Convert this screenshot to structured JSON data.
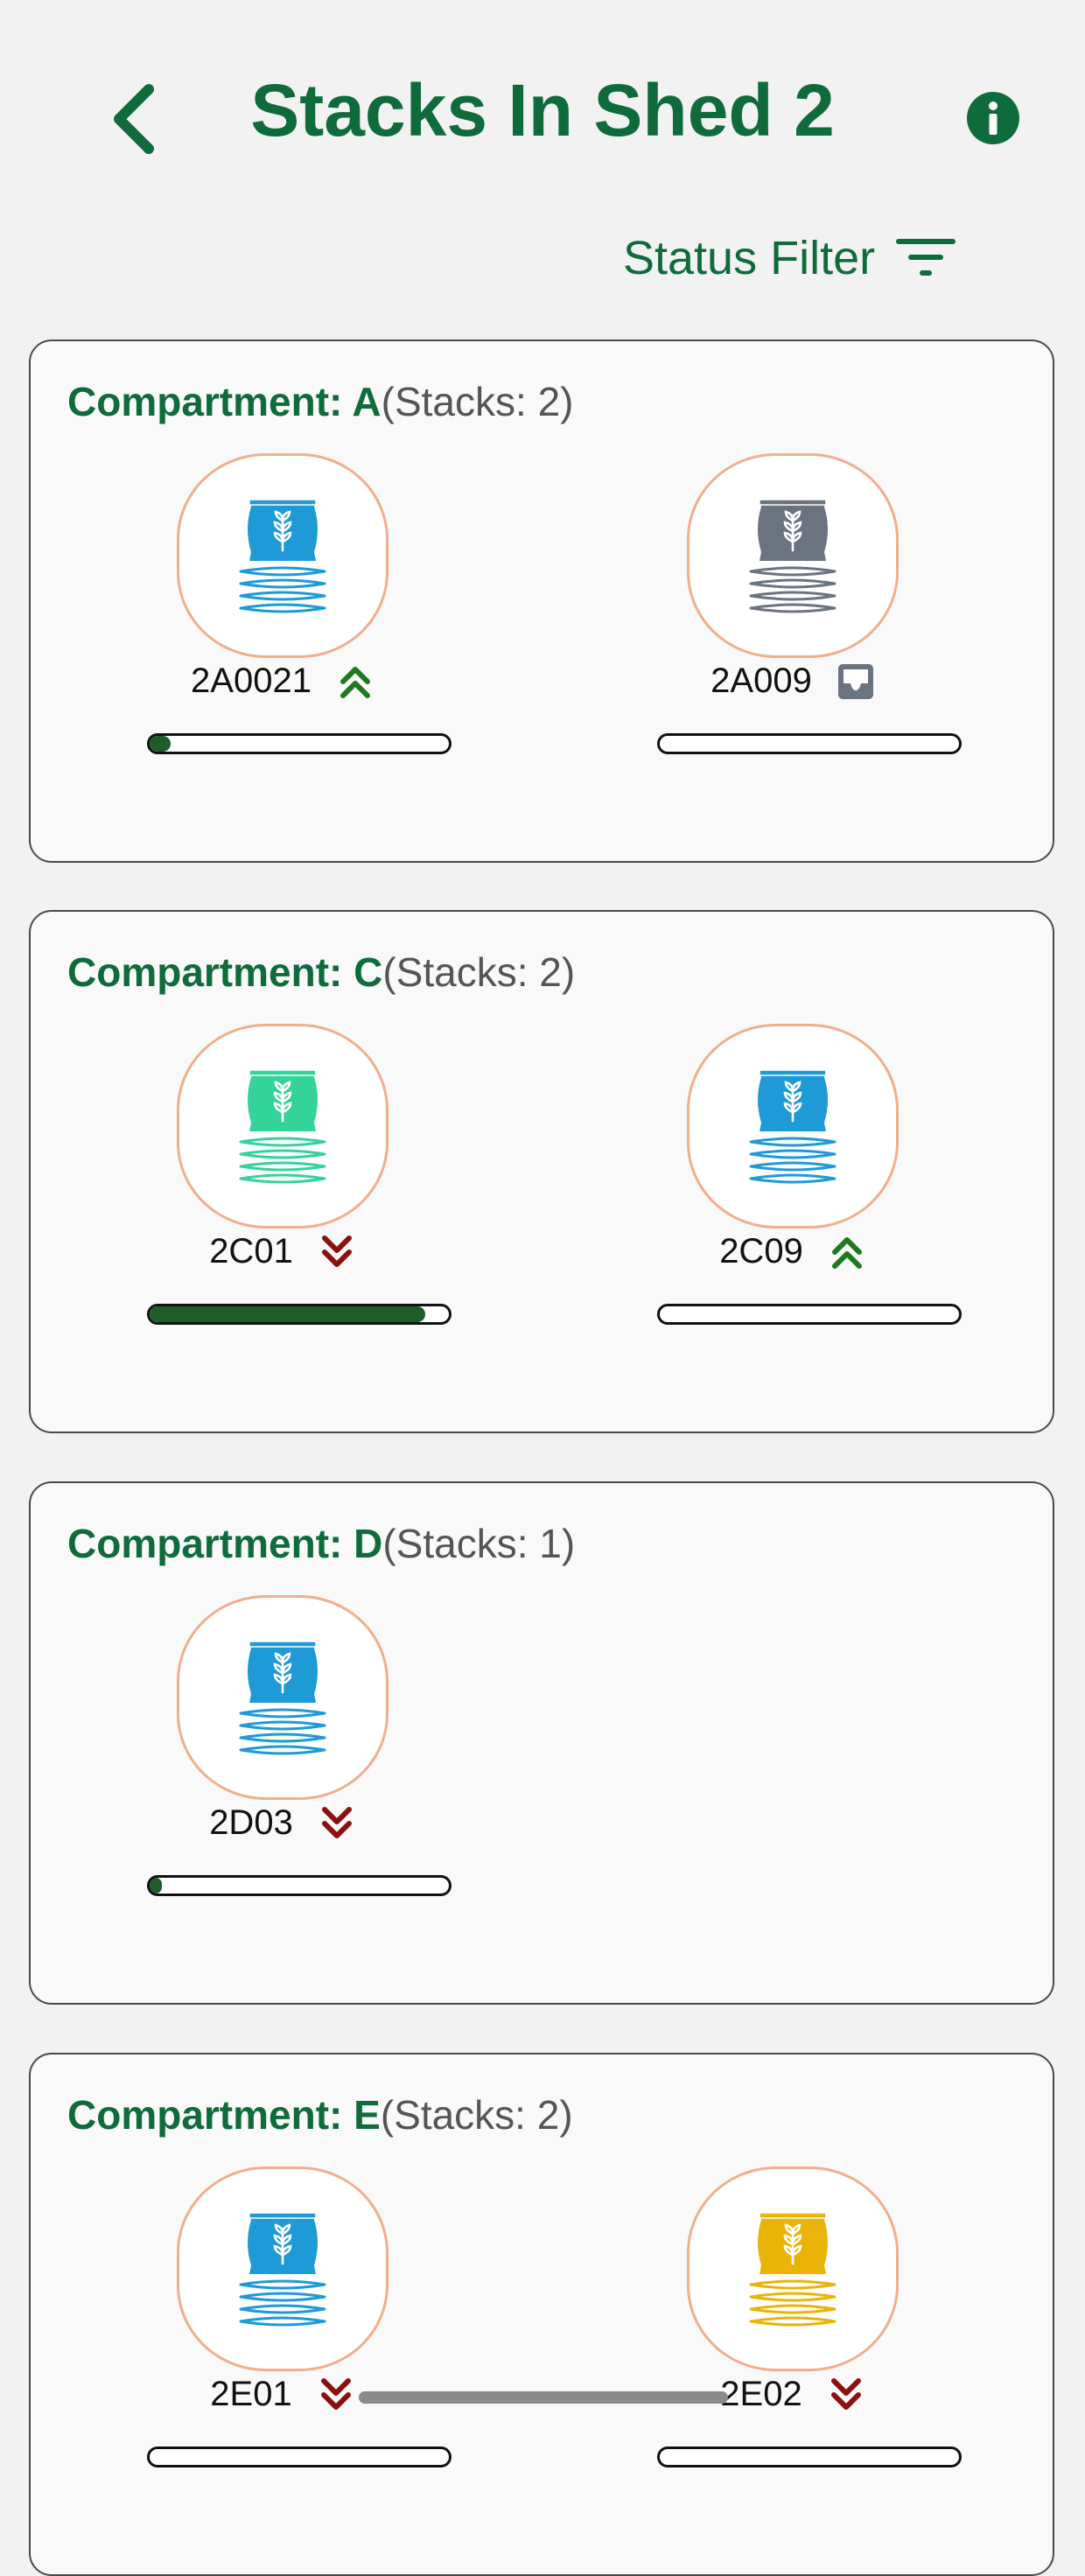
{
  "header": {
    "title": "Stacks In Shed 2",
    "back_icon": "chevron-left-icon",
    "info_icon": "info-icon"
  },
  "filter": {
    "label": "Status Filter",
    "icon": "filter-lines-icon"
  },
  "colors": {
    "brand_green": "#0f6b3c",
    "progress_fill": "#1e5c2a",
    "circle_border": "#efaf8c",
    "trend_up": "#1e7a1e",
    "trend_down": "#8b1010",
    "sack_blue": "#1e9ad6",
    "sack_gray": "#6b7280",
    "sack_green": "#34d399",
    "sack_yellow": "#eab308"
  },
  "compartments": [
    {
      "label": "Compartment: A",
      "count": "(Stacks: 2)",
      "stacks": [
        {
          "id": "2A0021",
          "status_icon": "double-chevron-up-icon",
          "sack_color": "#1e9ad6",
          "progress": 0.07
        },
        {
          "id": "2A009",
          "status_icon": "inbox-tray-icon",
          "sack_color": "#6b7280",
          "progress": 0.0
        }
      ]
    },
    {
      "label": "Compartment: C",
      "count": "(Stacks: 2)",
      "stacks": [
        {
          "id": "2C01",
          "status_icon": "double-chevron-down-icon",
          "sack_color": "#34d399",
          "progress": 0.92
        },
        {
          "id": "2C09",
          "status_icon": "double-chevron-up-icon",
          "sack_color": "#1e9ad6",
          "progress": 0.0
        }
      ]
    },
    {
      "label": "Compartment: D",
      "count": "(Stacks: 1)",
      "stacks": [
        {
          "id": "2D03",
          "status_icon": "double-chevron-down-icon",
          "sack_color": "#1e9ad6",
          "progress": 0.04
        }
      ]
    },
    {
      "label": "Compartment: E",
      "count": "(Stacks: 2)",
      "stacks": [
        {
          "id": "2E01",
          "status_icon": "double-chevron-down-icon",
          "sack_color": "#1e9ad6",
          "progress": 0.0
        },
        {
          "id": "2E02",
          "status_icon": "double-chevron-down-icon",
          "sack_color": "#eab308",
          "progress": 0.0
        }
      ]
    }
  ]
}
